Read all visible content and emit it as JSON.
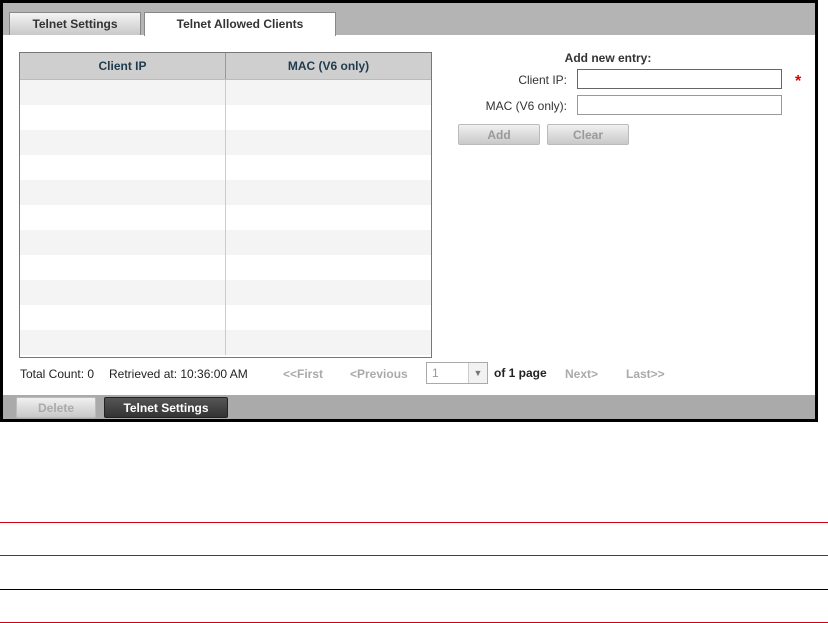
{
  "tabs": [
    "Telnet Settings",
    "Telnet Allowed Clients"
  ],
  "grid": {
    "columns": [
      "Client IP",
      "MAC (V6 only)"
    ],
    "row_count": 11
  },
  "form": {
    "title": "Add new entry:",
    "client_ip_label": "Client IP:",
    "mac_label": "MAC (V6 only):",
    "client_ip_value": "",
    "mac_value": "",
    "required_mark": "*",
    "add": "Add",
    "clear": "Clear"
  },
  "status": {
    "total_count": "Total Count: 0",
    "retrieved": "Retrieved at: 10:36:00 AM"
  },
  "pager": {
    "first": "<<First",
    "previous": "<Previous",
    "page": "1",
    "of": "of 1 page",
    "next": "Next>",
    "last": "Last>>"
  },
  "footer": {
    "delete": "Delete",
    "telnet_settings": "Telnet Settings"
  },
  "colors": {
    "required": "#e00000",
    "rule_red": "#d0021b"
  }
}
